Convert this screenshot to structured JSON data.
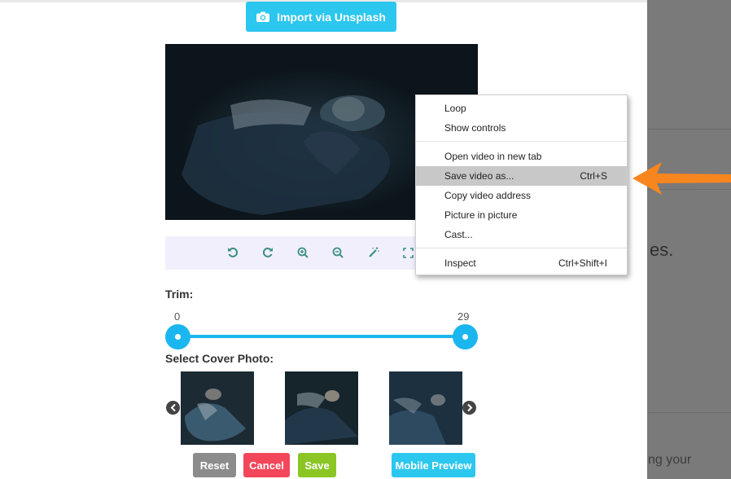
{
  "import_button": {
    "label": "Import via Unsplash",
    "icon": "camera-icon"
  },
  "toolbar": {
    "tools": [
      "rotate-left-icon",
      "rotate-right-icon",
      "zoom-in-icon",
      "zoom-out-icon",
      "magic-wand-icon",
      "fullscreen-icon"
    ]
  },
  "trim": {
    "label": "Trim:",
    "min": "0",
    "max": "29"
  },
  "cover": {
    "label": "Select Cover Photo:",
    "thumbnail_count": 3
  },
  "buttons": {
    "reset": "Reset",
    "cancel": "Cancel",
    "save": "Save",
    "mobile_preview": "Mobile Preview"
  },
  "context_menu": {
    "items": [
      {
        "label": "Loop",
        "shortcut": ""
      },
      {
        "label": "Show controls",
        "shortcut": ""
      },
      {
        "label": "Open video in new tab",
        "shortcut": ""
      },
      {
        "label": "Save video as...",
        "shortcut": "Ctrl+S",
        "highlighted": true
      },
      {
        "label": "Copy video address",
        "shortcut": ""
      },
      {
        "label": "Picture in picture",
        "shortcut": ""
      },
      {
        "label": "Cast...",
        "shortcut": ""
      },
      {
        "label": "Inspect",
        "shortcut": "Ctrl+Shift+I"
      }
    ]
  },
  "background_fragments": {
    "text1": "es.",
    "text2": "ng your"
  },
  "colors": {
    "accent": "#2cc7ee",
    "slider": "#1bb6ef",
    "reset": "#8c8c8c",
    "cancel": "#f2475a",
    "save": "#8bc624",
    "mobile_preview": "#2cc7ee",
    "pointer_arrow": "#f7861f"
  }
}
